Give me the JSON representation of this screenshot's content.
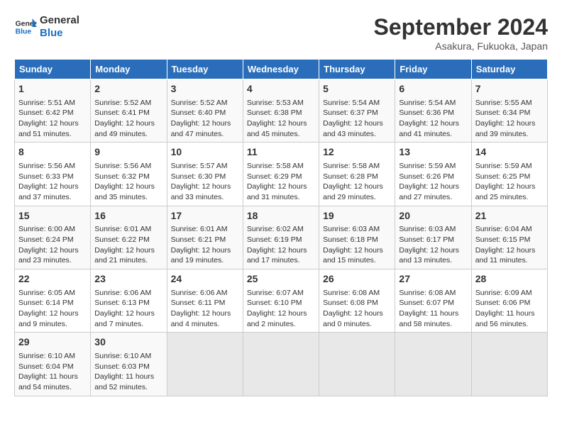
{
  "header": {
    "logo_line1": "General",
    "logo_line2": "Blue",
    "month": "September 2024",
    "location": "Asakura, Fukuoka, Japan"
  },
  "columns": [
    "Sunday",
    "Monday",
    "Tuesday",
    "Wednesday",
    "Thursday",
    "Friday",
    "Saturday"
  ],
  "weeks": [
    [
      {
        "day": "1",
        "info": "Sunrise: 5:51 AM\nSunset: 6:42 PM\nDaylight: 12 hours\nand 51 minutes."
      },
      {
        "day": "2",
        "info": "Sunrise: 5:52 AM\nSunset: 6:41 PM\nDaylight: 12 hours\nand 49 minutes."
      },
      {
        "day": "3",
        "info": "Sunrise: 5:52 AM\nSunset: 6:40 PM\nDaylight: 12 hours\nand 47 minutes."
      },
      {
        "day": "4",
        "info": "Sunrise: 5:53 AM\nSunset: 6:38 PM\nDaylight: 12 hours\nand 45 minutes."
      },
      {
        "day": "5",
        "info": "Sunrise: 5:54 AM\nSunset: 6:37 PM\nDaylight: 12 hours\nand 43 minutes."
      },
      {
        "day": "6",
        "info": "Sunrise: 5:54 AM\nSunset: 6:36 PM\nDaylight: 12 hours\nand 41 minutes."
      },
      {
        "day": "7",
        "info": "Sunrise: 5:55 AM\nSunset: 6:34 PM\nDaylight: 12 hours\nand 39 minutes."
      }
    ],
    [
      {
        "day": "8",
        "info": "Sunrise: 5:56 AM\nSunset: 6:33 PM\nDaylight: 12 hours\nand 37 minutes."
      },
      {
        "day": "9",
        "info": "Sunrise: 5:56 AM\nSunset: 6:32 PM\nDaylight: 12 hours\nand 35 minutes."
      },
      {
        "day": "10",
        "info": "Sunrise: 5:57 AM\nSunset: 6:30 PM\nDaylight: 12 hours\nand 33 minutes."
      },
      {
        "day": "11",
        "info": "Sunrise: 5:58 AM\nSunset: 6:29 PM\nDaylight: 12 hours\nand 31 minutes."
      },
      {
        "day": "12",
        "info": "Sunrise: 5:58 AM\nSunset: 6:28 PM\nDaylight: 12 hours\nand 29 minutes."
      },
      {
        "day": "13",
        "info": "Sunrise: 5:59 AM\nSunset: 6:26 PM\nDaylight: 12 hours\nand 27 minutes."
      },
      {
        "day": "14",
        "info": "Sunrise: 5:59 AM\nSunset: 6:25 PM\nDaylight: 12 hours\nand 25 minutes."
      }
    ],
    [
      {
        "day": "15",
        "info": "Sunrise: 6:00 AM\nSunset: 6:24 PM\nDaylight: 12 hours\nand 23 minutes."
      },
      {
        "day": "16",
        "info": "Sunrise: 6:01 AM\nSunset: 6:22 PM\nDaylight: 12 hours\nand 21 minutes."
      },
      {
        "day": "17",
        "info": "Sunrise: 6:01 AM\nSunset: 6:21 PM\nDaylight: 12 hours\nand 19 minutes."
      },
      {
        "day": "18",
        "info": "Sunrise: 6:02 AM\nSunset: 6:19 PM\nDaylight: 12 hours\nand 17 minutes."
      },
      {
        "day": "19",
        "info": "Sunrise: 6:03 AM\nSunset: 6:18 PM\nDaylight: 12 hours\nand 15 minutes."
      },
      {
        "day": "20",
        "info": "Sunrise: 6:03 AM\nSunset: 6:17 PM\nDaylight: 12 hours\nand 13 minutes."
      },
      {
        "day": "21",
        "info": "Sunrise: 6:04 AM\nSunset: 6:15 PM\nDaylight: 12 hours\nand 11 minutes."
      }
    ],
    [
      {
        "day": "22",
        "info": "Sunrise: 6:05 AM\nSunset: 6:14 PM\nDaylight: 12 hours\nand 9 minutes."
      },
      {
        "day": "23",
        "info": "Sunrise: 6:06 AM\nSunset: 6:13 PM\nDaylight: 12 hours\nand 7 minutes."
      },
      {
        "day": "24",
        "info": "Sunrise: 6:06 AM\nSunset: 6:11 PM\nDaylight: 12 hours\nand 4 minutes."
      },
      {
        "day": "25",
        "info": "Sunrise: 6:07 AM\nSunset: 6:10 PM\nDaylight: 12 hours\nand 2 minutes."
      },
      {
        "day": "26",
        "info": "Sunrise: 6:08 AM\nSunset: 6:08 PM\nDaylight: 12 hours\nand 0 minutes."
      },
      {
        "day": "27",
        "info": "Sunrise: 6:08 AM\nSunset: 6:07 PM\nDaylight: 11 hours\nand 58 minutes."
      },
      {
        "day": "28",
        "info": "Sunrise: 6:09 AM\nSunset: 6:06 PM\nDaylight: 11 hours\nand 56 minutes."
      }
    ],
    [
      {
        "day": "29",
        "info": "Sunrise: 6:10 AM\nSunset: 6:04 PM\nDaylight: 11 hours\nand 54 minutes."
      },
      {
        "day": "30",
        "info": "Sunrise: 6:10 AM\nSunset: 6:03 PM\nDaylight: 11 hours\nand 52 minutes."
      },
      {
        "day": "",
        "info": ""
      },
      {
        "day": "",
        "info": ""
      },
      {
        "day": "",
        "info": ""
      },
      {
        "day": "",
        "info": ""
      },
      {
        "day": "",
        "info": ""
      }
    ]
  ]
}
